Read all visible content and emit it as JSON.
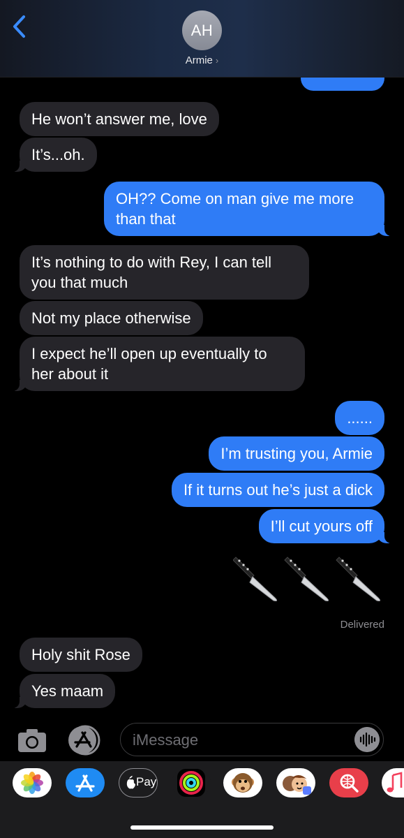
{
  "header": {
    "back_icon": "chevron-left-icon",
    "avatar_initials": "AH",
    "contact_name": "Armie",
    "contact_chevron": "›"
  },
  "messages": [
    {
      "from": "them",
      "text": "He won’t answer me, love"
    },
    {
      "from": "them",
      "text": "It’s...oh."
    },
    {
      "from": "me",
      "text": "OH?? Come on man give me more\nthan that"
    },
    {
      "from": "them",
      "text": "It’s nothing to do with Rey, I can tell\nyou that much"
    },
    {
      "from": "them",
      "text": "Not my place otherwise"
    },
    {
      "from": "them",
      "text": "I expect he’ll open up eventually to\nher about it"
    },
    {
      "from": "me",
      "text": "......"
    },
    {
      "from": "me",
      "text": "I’m trusting you, Armie"
    },
    {
      "from": "me",
      "text": "If it turns out he’s just a dick"
    },
    {
      "from": "me",
      "text": "I’ll cut yours off"
    },
    {
      "from": "me",
      "emoji": "knife-emoji ×3"
    },
    {
      "from": "them",
      "text": "Holy shit Rose"
    },
    {
      "from": "them",
      "text": "Yes maam"
    }
  ],
  "status": {
    "delivered": "Delivered"
  },
  "input": {
    "camera_icon": "camera-icon",
    "apps_icon": "app-store-icon",
    "placeholder": "iMessage",
    "audio_icon": "waveform-icon"
  },
  "app_drawer": {
    "items": [
      "photos-icon",
      "app-store-icon",
      "apple-pay-icon",
      "activity-icon",
      "monkey-animoji-icon",
      "memoji-stickers-icon",
      "web-search-icon",
      "music-icon"
    ],
    "apple_pay_label": "Pay"
  },
  "colors": {
    "outgoing": "#2f7cf6",
    "incoming": "#26252a",
    "background": "#000000"
  }
}
